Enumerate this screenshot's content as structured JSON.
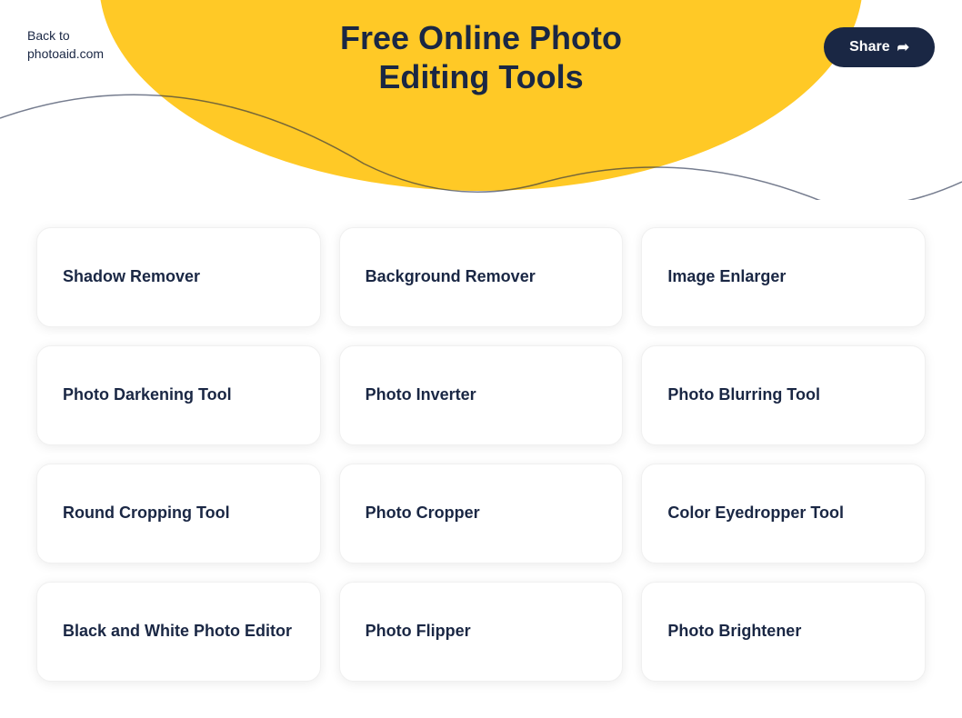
{
  "header": {
    "back_text": "Back to\nphotoaid.com",
    "title": "Free Online Photo Editing Tools",
    "share_label": "Share",
    "accent_color": "#FFC926",
    "dark_color": "#1a2744"
  },
  "tools": [
    {
      "id": "shadow-remover",
      "label": "Shadow Remover"
    },
    {
      "id": "background-remover",
      "label": "Background Remover"
    },
    {
      "id": "image-enlarger",
      "label": "Image Enlarger"
    },
    {
      "id": "photo-darkening-tool",
      "label": "Photo Darkening Tool"
    },
    {
      "id": "photo-inverter",
      "label": "Photo Inverter"
    },
    {
      "id": "photo-blurring-tool",
      "label": "Photo Blurring Tool"
    },
    {
      "id": "round-cropping-tool",
      "label": "Round Cropping Tool"
    },
    {
      "id": "photo-cropper",
      "label": "Photo Cropper"
    },
    {
      "id": "color-eyedropper-tool",
      "label": "Color Eyedropper Tool"
    },
    {
      "id": "black-and-white-photo-editor",
      "label": "Black and White Photo Editor"
    },
    {
      "id": "photo-flipper",
      "label": "Photo Flipper"
    },
    {
      "id": "photo-brightener",
      "label": "Photo Brightener"
    }
  ]
}
